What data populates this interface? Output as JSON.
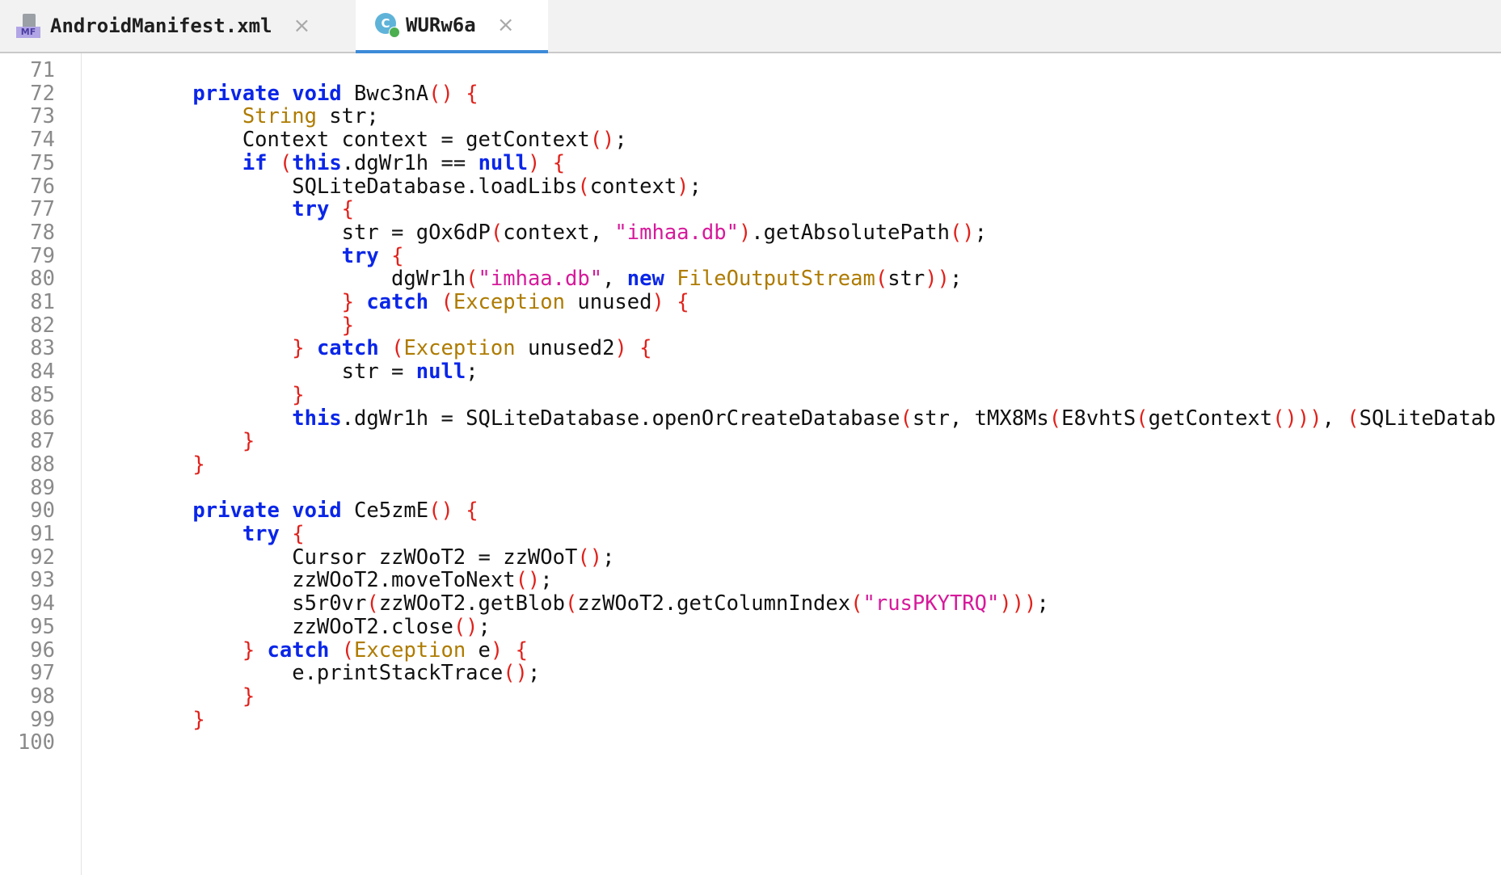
{
  "tabs": [
    {
      "label": "AndroidManifest.xml",
      "icon": "manifest-file-icon",
      "active": false
    },
    {
      "label": "WURw6a",
      "icon": "class-file-icon",
      "active": true
    }
  ],
  "icon_text": {
    "manifest": "MF",
    "class": "C"
  },
  "close_glyph": "×",
  "colors": {
    "keyword": "#0a26e8",
    "type": "#ae7b00",
    "paren": "#e0211b",
    "string": "#d61a9b",
    "line_number": "#8a8a8a",
    "active_tab_underline": "#3c8ad8"
  },
  "editor": {
    "lines": [
      {
        "n": "71",
        "tokens": []
      },
      {
        "n": "72",
        "tokens": [
          [
            "t",
            "    "
          ],
          [
            "k",
            "private"
          ],
          [
            "t",
            " "
          ],
          [
            "k",
            "void"
          ],
          [
            "t",
            " Bwc3nA"
          ],
          [
            "p",
            "()"
          ],
          [
            "t",
            " "
          ],
          [
            "p",
            "{"
          ]
        ]
      },
      {
        "n": "73",
        "tokens": [
          [
            "t",
            "        "
          ],
          [
            "y",
            "String"
          ],
          [
            "t",
            " str;"
          ]
        ]
      },
      {
        "n": "74",
        "tokens": [
          [
            "t",
            "        Context context = getContext"
          ],
          [
            "p",
            "()"
          ],
          [
            "t",
            ";"
          ]
        ]
      },
      {
        "n": "75",
        "tokens": [
          [
            "t",
            "        "
          ],
          [
            "k",
            "if"
          ],
          [
            "t",
            " "
          ],
          [
            "p",
            "("
          ],
          [
            "k",
            "this"
          ],
          [
            "t",
            ".dgWr1h == "
          ],
          [
            "k",
            "null"
          ],
          [
            "p",
            ")"
          ],
          [
            "t",
            " "
          ],
          [
            "p",
            "{"
          ]
        ]
      },
      {
        "n": "76",
        "tokens": [
          [
            "t",
            "            SQLiteDatabase.loadLibs"
          ],
          [
            "p",
            "("
          ],
          [
            "t",
            "context"
          ],
          [
            "p",
            ")"
          ],
          [
            "t",
            ";"
          ]
        ]
      },
      {
        "n": "77",
        "tokens": [
          [
            "t",
            "            "
          ],
          [
            "k",
            "try"
          ],
          [
            "t",
            " "
          ],
          [
            "p",
            "{"
          ]
        ]
      },
      {
        "n": "78",
        "tokens": [
          [
            "t",
            "                str = gOx6dP"
          ],
          [
            "p",
            "("
          ],
          [
            "t",
            "context, "
          ],
          [
            "s",
            "\"imhaa.db\""
          ],
          [
            "p",
            ")"
          ],
          [
            "t",
            ".getAbsolutePath"
          ],
          [
            "p",
            "()"
          ],
          [
            "t",
            ";"
          ]
        ]
      },
      {
        "n": "79",
        "tokens": [
          [
            "t",
            "                "
          ],
          [
            "k",
            "try"
          ],
          [
            "t",
            " "
          ],
          [
            "p",
            "{"
          ]
        ]
      },
      {
        "n": "80",
        "tokens": [
          [
            "t",
            "                    dgWr1h"
          ],
          [
            "p",
            "("
          ],
          [
            "s",
            "\"imhaa.db\""
          ],
          [
            "t",
            ", "
          ],
          [
            "k",
            "new"
          ],
          [
            "t",
            " "
          ],
          [
            "y",
            "FileOutputStream"
          ],
          [
            "p",
            "("
          ],
          [
            "t",
            "str"
          ],
          [
            "p",
            "))"
          ],
          [
            "t",
            ";"
          ]
        ]
      },
      {
        "n": "81",
        "tokens": [
          [
            "t",
            "                "
          ],
          [
            "p",
            "}"
          ],
          [
            "t",
            " "
          ],
          [
            "k",
            "catch"
          ],
          [
            "t",
            " "
          ],
          [
            "p",
            "("
          ],
          [
            "y",
            "Exception"
          ],
          [
            "t",
            " unused"
          ],
          [
            "p",
            ")"
          ],
          [
            "t",
            " "
          ],
          [
            "p",
            "{"
          ]
        ]
      },
      {
        "n": "82",
        "tokens": [
          [
            "t",
            "                "
          ],
          [
            "p",
            "}"
          ]
        ]
      },
      {
        "n": "83",
        "tokens": [
          [
            "t",
            "            "
          ],
          [
            "p",
            "}"
          ],
          [
            "t",
            " "
          ],
          [
            "k",
            "catch"
          ],
          [
            "t",
            " "
          ],
          [
            "p",
            "("
          ],
          [
            "y",
            "Exception"
          ],
          [
            "t",
            " unused2"
          ],
          [
            "p",
            ")"
          ],
          [
            "t",
            " "
          ],
          [
            "p",
            "{"
          ]
        ]
      },
      {
        "n": "84",
        "tokens": [
          [
            "t",
            "                str = "
          ],
          [
            "k",
            "null"
          ],
          [
            "t",
            ";"
          ]
        ]
      },
      {
        "n": "85",
        "tokens": [
          [
            "t",
            "            "
          ],
          [
            "p",
            "}"
          ]
        ]
      },
      {
        "n": "86",
        "tokens": [
          [
            "t",
            "            "
          ],
          [
            "k",
            "this"
          ],
          [
            "t",
            ".dgWr1h = SQLiteDatabase.openOrCreateDatabase"
          ],
          [
            "p",
            "("
          ],
          [
            "t",
            "str, tMX8Ms"
          ],
          [
            "p",
            "("
          ],
          [
            "t",
            "E8vhtS"
          ],
          [
            "p",
            "("
          ],
          [
            "t",
            "getContext"
          ],
          [
            "p",
            "()))"
          ],
          [
            "t",
            ", "
          ],
          [
            "p",
            "("
          ],
          [
            "t",
            "SQLiteDatab"
          ]
        ]
      },
      {
        "n": "87",
        "tokens": [
          [
            "t",
            "        "
          ],
          [
            "p",
            "}"
          ]
        ]
      },
      {
        "n": "88",
        "tokens": [
          [
            "t",
            "    "
          ],
          [
            "p",
            "}"
          ]
        ]
      },
      {
        "n": "89",
        "tokens": []
      },
      {
        "n": "90",
        "tokens": [
          [
            "t",
            "    "
          ],
          [
            "k",
            "private"
          ],
          [
            "t",
            " "
          ],
          [
            "k",
            "void"
          ],
          [
            "t",
            " Ce5zmE"
          ],
          [
            "p",
            "()"
          ],
          [
            "t",
            " "
          ],
          [
            "p",
            "{"
          ]
        ]
      },
      {
        "n": "91",
        "tokens": [
          [
            "t",
            "        "
          ],
          [
            "k",
            "try"
          ],
          [
            "t",
            " "
          ],
          [
            "p",
            "{"
          ]
        ]
      },
      {
        "n": "92",
        "tokens": [
          [
            "t",
            "            Cursor zzWOoT2 = zzWOoT"
          ],
          [
            "p",
            "()"
          ],
          [
            "t",
            ";"
          ]
        ]
      },
      {
        "n": "93",
        "tokens": [
          [
            "t",
            "            zzWOoT2.moveToNext"
          ],
          [
            "p",
            "()"
          ],
          [
            "t",
            ";"
          ]
        ]
      },
      {
        "n": "94",
        "tokens": [
          [
            "t",
            "            s5r0vr"
          ],
          [
            "p",
            "("
          ],
          [
            "t",
            "zzWOoT2.getBlob"
          ],
          [
            "p",
            "("
          ],
          [
            "t",
            "zzWOoT2.getColumnIndex"
          ],
          [
            "p",
            "("
          ],
          [
            "s",
            "\"rusPKYTRQ\""
          ],
          [
            "p",
            ")))"
          ],
          [
            "t",
            ";"
          ]
        ]
      },
      {
        "n": "95",
        "tokens": [
          [
            "t",
            "            zzWOoT2.close"
          ],
          [
            "p",
            "()"
          ],
          [
            "t",
            ";"
          ]
        ]
      },
      {
        "n": "96",
        "tokens": [
          [
            "t",
            "        "
          ],
          [
            "p",
            "}"
          ],
          [
            "t",
            " "
          ],
          [
            "k",
            "catch"
          ],
          [
            "t",
            " "
          ],
          [
            "p",
            "("
          ],
          [
            "y",
            "Exception"
          ],
          [
            "t",
            " e"
          ],
          [
            "p",
            ")"
          ],
          [
            "t",
            " "
          ],
          [
            "p",
            "{"
          ]
        ]
      },
      {
        "n": "97",
        "tokens": [
          [
            "t",
            "            e.printStackTrace"
          ],
          [
            "p",
            "()"
          ],
          [
            "t",
            ";"
          ]
        ]
      },
      {
        "n": "98",
        "tokens": [
          [
            "t",
            "        "
          ],
          [
            "p",
            "}"
          ]
        ]
      },
      {
        "n": "99",
        "tokens": [
          [
            "t",
            "    "
          ],
          [
            "p",
            "}"
          ]
        ]
      },
      {
        "n": "100",
        "tokens": []
      }
    ]
  }
}
